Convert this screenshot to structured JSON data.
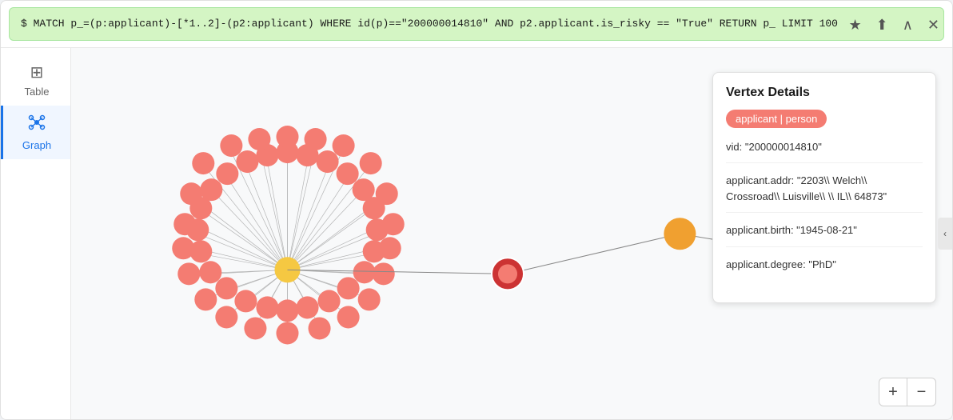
{
  "query": {
    "text": "$ MATCH p_=(p:applicant)-[*1..2]-(p2:applicant) WHERE id(p)==\"200000014810\" AND p2.applicant.is_risky == \"True\" RETURN p_ LIMIT 100"
  },
  "query_actions": {
    "star_label": "★",
    "share_label": "⬆",
    "collapse_label": "∧",
    "close_label": "✕"
  },
  "sidebar": {
    "items": [
      {
        "id": "table",
        "label": "Table",
        "icon": "⊞"
      },
      {
        "id": "graph",
        "label": "Graph",
        "icon": "⟊"
      }
    ]
  },
  "vertex_panel": {
    "title": "Vertex Details",
    "tag": "applicant | person",
    "fields": [
      {
        "label": "vid",
        "value": "\"200000014810\""
      },
      {
        "label": "applicant.addr",
        "value": "\"2203\\\\ Welch\\\\ Crossroad\\\\ Luisville\\\\ \\\\ IL\\\\ 64873\""
      },
      {
        "label": "applicant.birth",
        "value": "\"1945-08-21\""
      },
      {
        "label": "applicant.degree",
        "value": "\"PhD\""
      }
    ]
  },
  "zoom": {
    "plus_label": "+",
    "minus_label": "−"
  },
  "colors": {
    "coral": "#f47c72",
    "yellow": "#f5c842",
    "orange": "#f0a030",
    "query_bg": "#d4f5c4",
    "query_border": "#a8e6a0"
  }
}
